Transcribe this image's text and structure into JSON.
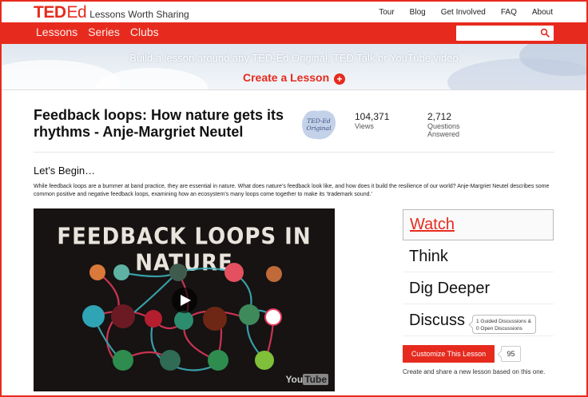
{
  "brand": {
    "ted": "TED",
    "ed": "Ed",
    "tagline": "Lessons Worth Sharing",
    "accent": "#e62b1e"
  },
  "topnav": [
    "Tour",
    "Blog",
    "Get Involved",
    "FAQ",
    "About"
  ],
  "mainnav": [
    "Lessons",
    "Series",
    "Clubs"
  ],
  "search": {
    "placeholder": "",
    "icon": "search-icon"
  },
  "banner": {
    "text": "Build a lesson around any TED-Ed Original, TED Talk or YouTube video",
    "cta": "Create a Lesson"
  },
  "lesson": {
    "title": "Feedback loops: How nature gets its rhythms - Anje-Margriet Neutel",
    "badge": [
      "TED-Ed",
      "Original"
    ],
    "views": "104,371",
    "views_label": "Views",
    "questions": "2,712",
    "questions_label": [
      "Questions",
      "Answered"
    ],
    "begin": "Let’s Begin…",
    "description": "While feedback loops are a bummer at band practice, they are essential in nature. What does nature’s feedback look like, and how does it build the resilience of our world? Anje-Margriet Neutel describes some common positive and negative feedback loops, examining how an ecosystem’s many loops come together to make its ‘trademark sound.’"
  },
  "video": {
    "title": "FEEDBACK LOOPS IN NATURE",
    "yt_a": "You",
    "yt_b": "Tube"
  },
  "menu": [
    "Watch",
    "Think",
    "Dig Deeper",
    "Discuss"
  ],
  "discuss_bubble": [
    "1 Guided Discussions &",
    "0 Open Discussions"
  ],
  "customize": {
    "label": "Customize This Lesson",
    "count": "95",
    "note": "Create and share a new lesson based on this one."
  }
}
